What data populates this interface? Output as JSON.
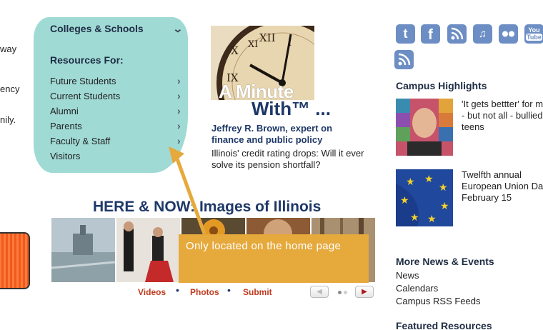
{
  "left_fragments": [
    "way",
    "ency",
    "nily."
  ],
  "menu": {
    "colleges_label": "Colleges & Schools",
    "resources_title": "Resources For:",
    "items": [
      "Future Students",
      "Current Students",
      "Alumni",
      "Parents",
      "Faculty & Staff",
      "Visitors"
    ]
  },
  "feature": {
    "title_line1": "A Minute",
    "title_line2": "With™ ...",
    "headline": "Jeffrey R. Brown, expert on finance and public policy",
    "body": "Illinois' credit rating drops: Will it ever solve its pension shortfall?"
  },
  "here_now": {
    "title": "HERE & NOW: Images of Illinois",
    "links": [
      "Videos",
      "Photos",
      "Submit"
    ],
    "prev_glyph": "◀",
    "next_glyph": "▶"
  },
  "callout": {
    "text": "Only located on the home page"
  },
  "social_icons": [
    "twitter-icon",
    "facebook-icon",
    "rss-icon",
    "itunes-icon",
    "flickr-icon",
    "youtube-icon",
    "podcast-icon"
  ],
  "social": {
    "twitter_glyph": "t",
    "facebook_glyph": "f",
    "itunes_glyph": "♫",
    "youtube_line1": "You",
    "youtube_line2": "Tube"
  },
  "highlights": {
    "title": "Campus Highlights",
    "items": [
      {
        "lines": [
          "'It gets bettter' for m",
          "- but not all - bullied",
          "teens"
        ]
      },
      {
        "lines": [
          "Twelfth annual",
          "European Union Day",
          "February 15"
        ]
      }
    ]
  },
  "more_news": {
    "title": "More News & Events",
    "links": [
      "News",
      "Calendars",
      "Campus RSS Feeds"
    ]
  },
  "featured_resources": {
    "title": "Featured Resources"
  },
  "colors": {
    "menu_bg": "#a0dad5",
    "navy": "#1e3868",
    "link_red": "#c03a1e",
    "callout": "#e6a93c",
    "social_blue": "#6c8ec4"
  }
}
